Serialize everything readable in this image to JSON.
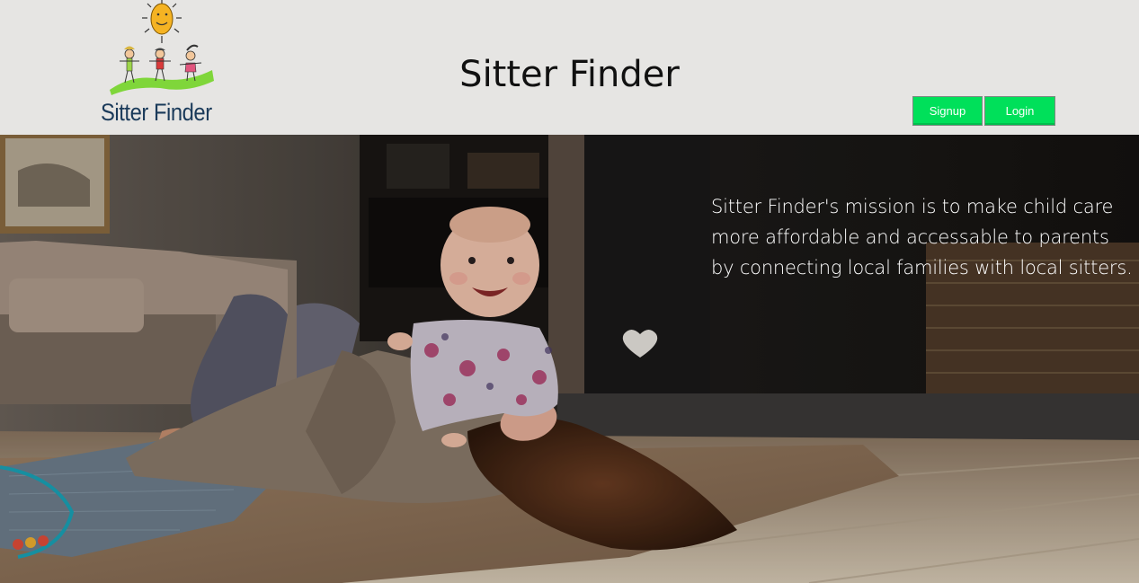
{
  "header": {
    "logo_text": "Sitter Finder",
    "title": "Sitter Finder",
    "signup_label": "Signup",
    "login_label": "Login",
    "button_color": "#00e05a",
    "background_color": "#e6e5e3"
  },
  "hero": {
    "mission": "Sitter Finder's mission is to make child care more affordable and accessable to parents by connecting local families with local sitters.",
    "photo_subject": "mother-and-baby-playing-photo"
  }
}
